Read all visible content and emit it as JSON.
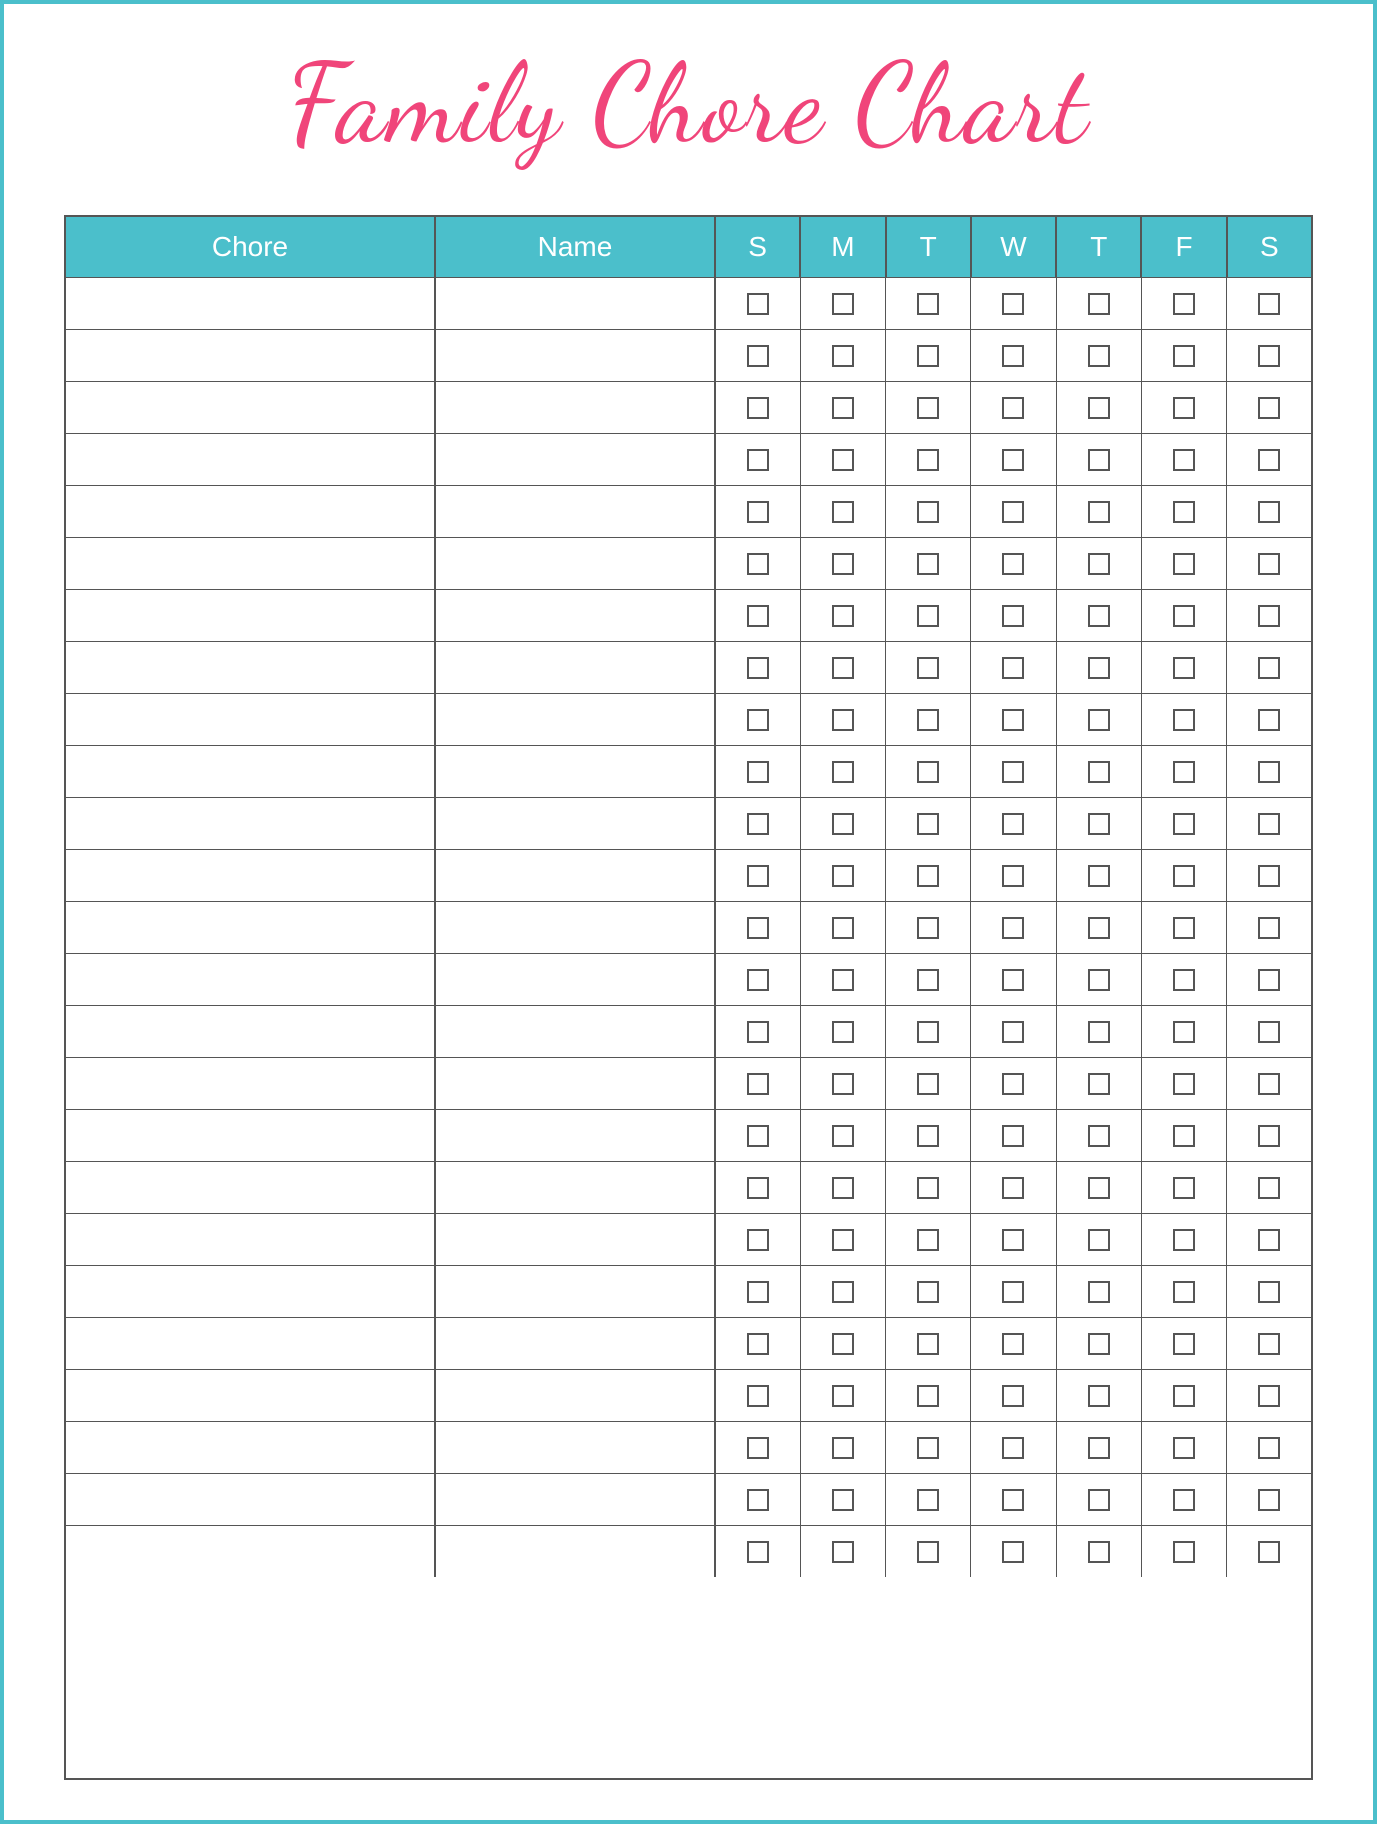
{
  "page": {
    "title": "Family Chore Chart",
    "border_color": "#4bbfcb",
    "title_color": "#f0457a"
  },
  "header": {
    "chore_label": "Chore",
    "name_label": "Name",
    "days": [
      "S",
      "M",
      "T",
      "W",
      "T",
      "F",
      "S"
    ]
  },
  "rows": [
    {},
    {},
    {},
    {},
    {},
    {},
    {},
    {},
    {},
    {},
    {},
    {},
    {},
    {},
    {},
    {},
    {},
    {},
    {},
    {},
    {},
    {},
    {},
    {},
    {}
  ]
}
